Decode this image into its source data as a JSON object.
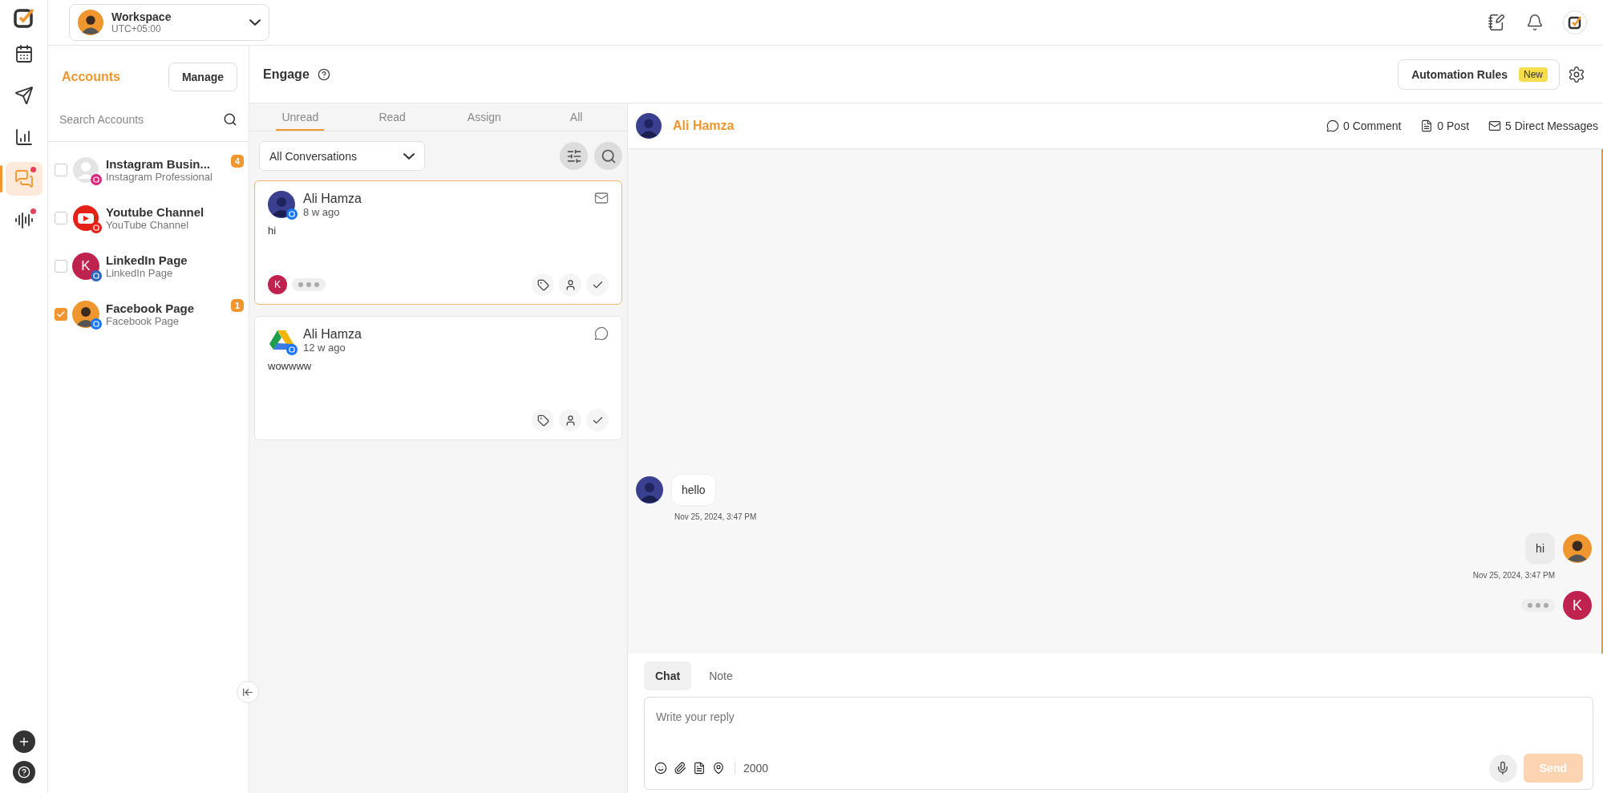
{
  "workspace": {
    "name": "Workspace",
    "timezone": "UTC+05:00"
  },
  "nav": [
    {
      "kind": "calendar",
      "selected": false,
      "dot": false
    },
    {
      "kind": "publish",
      "selected": false,
      "dot": false
    },
    {
      "kind": "analytics",
      "selected": false,
      "dot": false
    },
    {
      "kind": "engage",
      "selected": true,
      "dot": true
    },
    {
      "kind": "listening",
      "selected": false,
      "dot": true
    }
  ],
  "accounts": {
    "title": "Accounts",
    "manage": "Manage",
    "search_placeholder": "Search Accounts",
    "items": [
      {
        "kind": "instagram",
        "name": "Instagram Busin...",
        "type": "Instagram Professional",
        "checked": false,
        "badge": "4"
      },
      {
        "kind": "youtube",
        "name": "Youtube Channel",
        "type": "YouTube Channel",
        "checked": false
      },
      {
        "kind": "linkedin",
        "name": "LinkedIn Page",
        "type": "LinkedIn Page",
        "letter": "K",
        "checked": false
      },
      {
        "kind": "facebook",
        "name": "Facebook Page",
        "type": "Facebook Page",
        "checked": true,
        "badge": "1"
      }
    ]
  },
  "engage": {
    "title": "Engage",
    "tabs": [
      {
        "label": "Unread",
        "selected": true
      },
      {
        "label": "Read",
        "selected": false
      },
      {
        "label": "Assign",
        "selected": false
      },
      {
        "label": "All",
        "selected": false
      }
    ],
    "filter": "All Conversations",
    "conversations": [
      {
        "kind": "message",
        "name": "Ali Hamza",
        "time": "8 w ago",
        "text": "hi",
        "selected": true,
        "avatar": {
          "kind": "person"
        },
        "assignee": "K",
        "typing": true
      },
      {
        "kind": "comment",
        "name": "Ali Hamza",
        "time": "12 w ago",
        "text": "wowwww",
        "selected": false,
        "avatar": {
          "kind": "triangle"
        },
        "typing": false
      }
    ]
  },
  "chat": {
    "automation": "Automation Rules",
    "new_badge": "New",
    "contact": "Ali Hamza",
    "stats": [
      {
        "kind": "comment",
        "label": "0 Comment"
      },
      {
        "kind": "post",
        "label": "0 Post"
      },
      {
        "kind": "dm",
        "label": "5 Direct Messages"
      }
    ],
    "messages": [
      {
        "kind": "received",
        "text": "hello",
        "time": "Nov 25, 2024, 3:47 PM"
      },
      {
        "kind": "sent",
        "text": "hi",
        "time": "Nov 25, 2024, 3:47 PM"
      },
      {
        "kind": "typing",
        "letter": "K"
      }
    ],
    "composer": {
      "tabs": [
        {
          "label": "Chat",
          "selected": true
        },
        {
          "label": "Note",
          "selected": false
        }
      ],
      "placeholder": "Write your reply",
      "count": "2000",
      "send": "Send"
    }
  }
}
